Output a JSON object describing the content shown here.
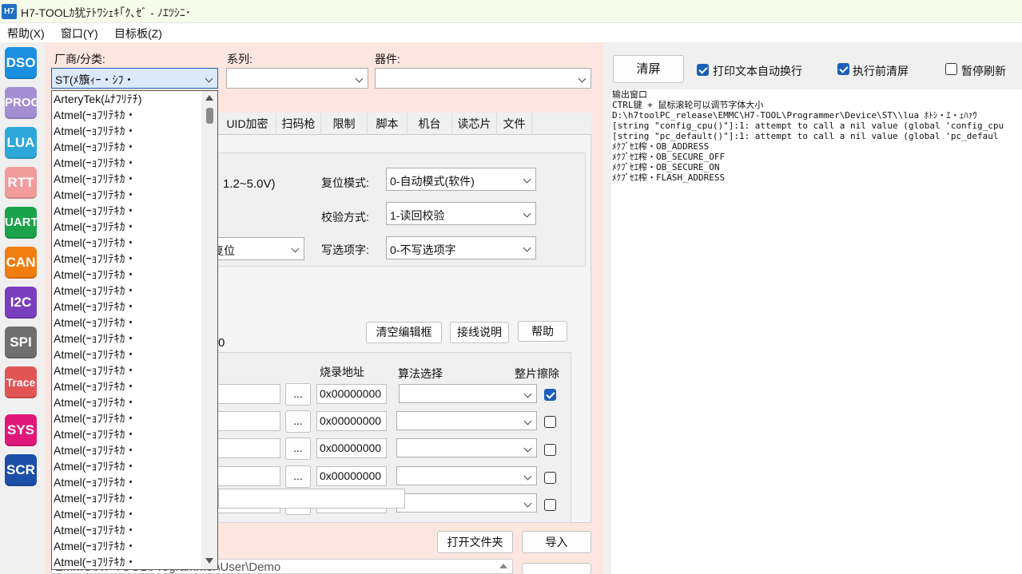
{
  "window": {
    "title": "H7-TOOLｶ犹ﾃﾄﾜｼｪｷ｢ｸ､ｾﾞ - ﾉｴﾂｼﾆ･",
    "icon_text": "H7"
  },
  "menu": [
    "帮助(X)",
    "窗口(Y)",
    "目标板(Z)"
  ],
  "sidebar": [
    {
      "label": "DSO",
      "color": "#1a8fe0"
    },
    {
      "label": "PROG",
      "color": "#a48fd4"
    },
    {
      "label": "LUA",
      "color": "#2ea8d8"
    },
    {
      "label": "RTT",
      "color": "#f29b9b"
    },
    {
      "label": "UART",
      "color": "#1aa34a"
    },
    {
      "label": "CAN",
      "color": "#f07d10"
    },
    {
      "label": "I2C",
      "color": "#7a3fbf"
    },
    {
      "label": "SPI",
      "color": "#6f6f6f"
    },
    {
      "label": "Trace",
      "color": "#e25555"
    },
    {
      "label": "SYS",
      "color": "#e0187a"
    },
    {
      "label": "SCR",
      "color": "#1b4fa8"
    }
  ],
  "selector": {
    "vendor_label": "厂商/分类:",
    "vendor_value": "ST(ﾒ籏ｨｰ・ｼﾌ・",
    "series_label": "系列:",
    "device_label": "器件:"
  },
  "tabs": [
    "UID加密",
    "扫码枪",
    "限制",
    "脚本",
    "机台",
    "读芯片",
    "文件"
  ],
  "settings": {
    "voltage_partial": "1.2~5.0V)",
    "reset_partial": "复位",
    "reset_mode_label": "复位模式:",
    "reset_mode_value": "0-自动模式(软件)",
    "verify_label": "校验方式:",
    "verify_value": "1-读回校验",
    "option_label": "写选项字:",
    "option_value": "0-不写选项字"
  },
  "toolbar": {
    "clear_edit": "清空编辑框",
    "wiring": "接线说明",
    "help": "帮助",
    "partial_zero": "0"
  },
  "file_table": {
    "headers": {
      "address": "烧录地址",
      "algorithm": "算法选择",
      "erase": "整片擦除"
    },
    "browse_label": "...",
    "rows": [
      {
        "address": "0x00000000",
        "erase": true
      },
      {
        "address": "0x00000000",
        "erase": false
      },
      {
        "address": "0x00000000",
        "erase": false
      },
      {
        "address": "0x00000000",
        "erase": false
      },
      {
        "address": "0x00000000",
        "erase": false
      }
    ]
  },
  "bottom": {
    "open_folder": "打开文件夹",
    "import": "导入",
    "path_partial": "EMMC\\H7-TOOL\\Programmer\\User\\Demo"
  },
  "dropdown": {
    "items": [
      "ArteryTek(ﾑﾅﾌﾘﾃﾁ)",
      "Atmel(ｰｮﾌﾘﾃｷｶ・",
      "Atmel(ｰｮﾌﾘﾃｷｶ・",
      "Atmel(ｰｮﾌﾘﾃｷｶ・",
      "Atmel(ｰｮﾌﾘﾃｷｶ・",
      "Atmel(ｰｮﾌﾘﾃｷｶ・",
      "Atmel(ｰｮﾌﾘﾃｷｶ・",
      "Atmel(ｰｮﾌﾘﾃｷｶ・",
      "Atmel(ｰｮﾌﾘﾃｷｶ・",
      "Atmel(ｰｮﾌﾘﾃｷｶ・",
      "Atmel(ｰｮﾌﾘﾃｷｶ・",
      "Atmel(ｰｮﾌﾘﾃｷｶ・",
      "Atmel(ｰｮﾌﾘﾃｷｶ・",
      "Atmel(ｰｮﾌﾘﾃｷｶ・",
      "Atmel(ｰｮﾌﾘﾃｷｶ・",
      "Atmel(ｰｮﾌﾘﾃｷｶ・",
      "Atmel(ｰｮﾌﾘﾃｷｶ・",
      "Atmel(ｰｮﾌﾘﾃｷｶ・",
      "Atmel(ｰｮﾌﾘﾃｷｶ・",
      "Atmel(ｰｮﾌﾘﾃｷｶ・",
      "Atmel(ｰｮﾌﾘﾃｷｶ・",
      "Atmel(ｰｮﾌﾘﾃｷｶ・",
      "Atmel(ｰｮﾌﾘﾃｷｶ・",
      "Atmel(ｰｮﾌﾘﾃｷｶ・",
      "Atmel(ｰｮﾌﾘﾃｷｶ・",
      "Atmel(ｰｮﾌﾘﾃｷｶ・",
      "Atmel(ｰｮﾌﾘﾃｷｶ・",
      "Atmel(ｰｮﾌﾘﾃｷｶ・",
      "Atmel(ｰｮﾌﾘﾃｷｶ・",
      "Atmel(ｰｮﾌﾘﾃｷｶ・"
    ]
  },
  "output_panel": {
    "clear_button": "清屏",
    "wrap_label": "打印文本自动换行",
    "wrap_checked": true,
    "clear_before_label": "执行前清屏",
    "clear_before_checked": true,
    "pause_label": "暂停刷新",
    "pause_checked": false,
    "lines": [
      "输出窗口",
      "CTRL键 + 鼠标滚轮可以调节字体大小",
      "D:\\h7toolPC_release\\EMMC\\H7-TOOL\\Programmer\\Device\\ST\\\\lua  ﾎﾄｼ・ｴ・ｪﾊｧｳ",
      "[string \"config_cpu()\"]:1: attempt to call a nil value (global 'config_cpu",
      "[string \"pc_default()\"]:1: attempt to call a nil value (global 'pc_defaul",
      "ﾒｸﾌﾞｾｴ榨・OB_ADDRESS",
      "ﾒｸﾌﾞｾｴ榨・OB_SECURE_OFF",
      "ﾒｸﾌﾞｾｴ榨・OB_SECURE_ON",
      "ﾒｸﾌﾞｾｴ榨・FLASH_ADDRESS"
    ]
  }
}
